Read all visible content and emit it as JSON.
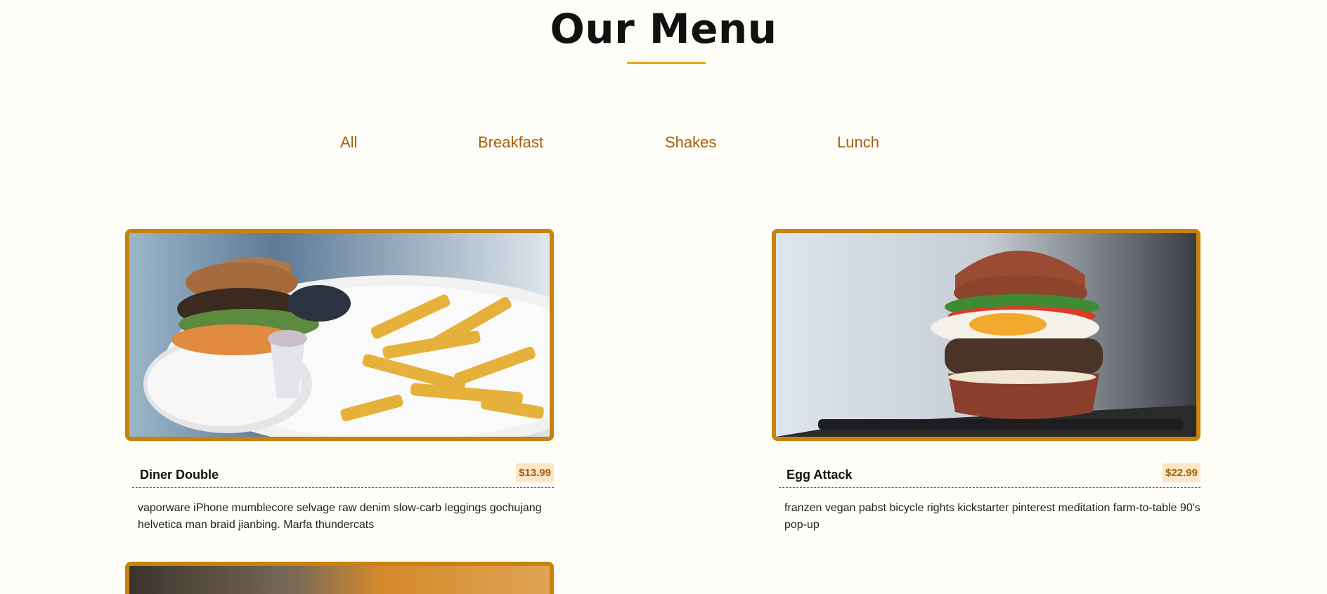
{
  "page": {
    "title": "Our Menu"
  },
  "filters": [
    {
      "label": "All"
    },
    {
      "label": "Breakfast"
    },
    {
      "label": "Shakes"
    },
    {
      "label": "Lunch"
    }
  ],
  "items": [
    {
      "name": "Diner Double",
      "price": "$13.99",
      "description": "vaporware iPhone mumblecore selvage raw denim slow-carb leggings gochujang helvetica man braid jianbing. Marfa thundercats",
      "image_icon": "burger-fries-photo"
    },
    {
      "name": "Egg Attack",
      "price": "$22.99",
      "description": "franzen vegan pabst bicycle rights kickstarter pinterest meditation farm-to-table 90's pop-up",
      "image_icon": "egg-burger-photo"
    }
  ],
  "colors": {
    "accent": "#c7830d",
    "filter_text": "#a35f0d",
    "price_bg": "#fbe6c6",
    "background": "#fffdf7"
  }
}
